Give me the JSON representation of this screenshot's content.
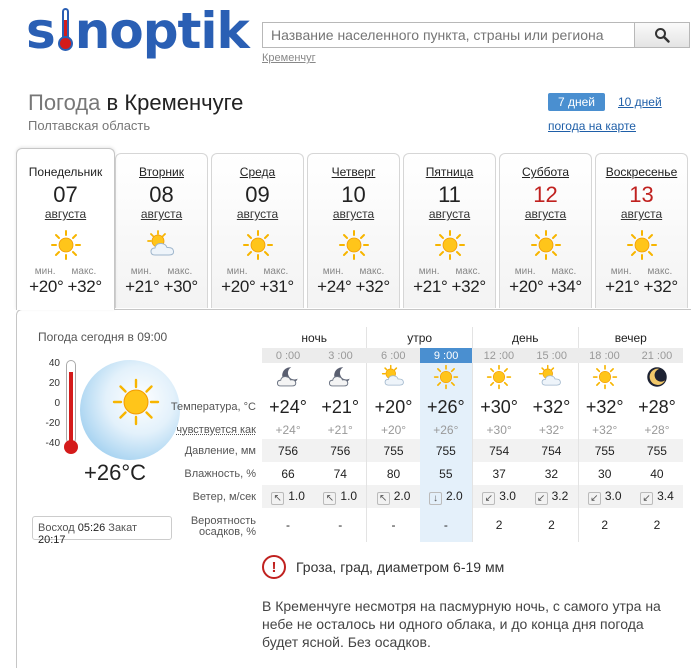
{
  "logo": {
    "pre": "s",
    "post": "noptik"
  },
  "search": {
    "placeholder": "Название населенного пункта, страны или региона",
    "hint": "Кременчуг"
  },
  "title": {
    "prefix": "Погода",
    "city": "в Кременчуге"
  },
  "region": "Полтавская область",
  "tabs": {
    "seven": "7 дней",
    "ten": "10 дней",
    "map": "погода на карте"
  },
  "days": [
    {
      "name": "Понедельник",
      "date": "07",
      "month": "августа",
      "icon": "sun-icon",
      "min_label": "мин.",
      "max_label": "макс.",
      "min": "+20°",
      "max": "+32°",
      "weekend": false,
      "active": true
    },
    {
      "name": "Вторник",
      "date": "08",
      "month": "августа",
      "icon": "sun-cloud-icon",
      "min_label": "мин.",
      "max_label": "макс.",
      "min": "+21°",
      "max": "+30°",
      "weekend": false,
      "active": false
    },
    {
      "name": "Среда",
      "date": "09",
      "month": "августа",
      "icon": "sun-icon",
      "min_label": "мин.",
      "max_label": "макс.",
      "min": "+20°",
      "max": "+31°",
      "weekend": false,
      "active": false
    },
    {
      "name": "Четверг",
      "date": "10",
      "month": "августа",
      "icon": "sun-icon",
      "min_label": "мин.",
      "max_label": "макс.",
      "min": "+24°",
      "max": "+32°",
      "weekend": false,
      "active": false
    },
    {
      "name": "Пятница",
      "date": "11",
      "month": "августа",
      "icon": "sun-icon",
      "min_label": "мин.",
      "max_label": "макс.",
      "min": "+21°",
      "max": "+32°",
      "weekend": false,
      "active": false
    },
    {
      "name": "Суббота",
      "date": "12",
      "month": "августа",
      "icon": "sun-icon",
      "min_label": "мин.",
      "max_label": "макс.",
      "min": "+20°",
      "max": "+34°",
      "weekend": true,
      "active": false
    },
    {
      "name": "Воскресенье",
      "date": "13",
      "month": "августа",
      "icon": "sun-icon",
      "min_label": "мин.",
      "max_label": "макс.",
      "min": "+21°",
      "max": "+32°",
      "weekend": true,
      "active": false
    }
  ],
  "now": {
    "label": "Погода сегодня в 09:00",
    "scale": [
      "40",
      "20",
      "0",
      "-20",
      "-40"
    ],
    "temp": "+26°C",
    "sunrise_label": "Восход",
    "sunrise": "05:26",
    "sunset_label": "Закат",
    "sunset": "20:17"
  },
  "table": {
    "groups": [
      "ночь",
      "утро",
      "день",
      "вечер"
    ],
    "hours": [
      "0 :00",
      "3 :00",
      "6 :00",
      "9 :00",
      "12 :00",
      "15 :00",
      "18 :00",
      "21 :00"
    ],
    "current_index": 3,
    "icons": [
      "moon-cloud-icon",
      "moon-cloud-icon",
      "sun-cloud-icon",
      "sun-icon",
      "sun-icon",
      "sun-cloud-icon",
      "sun-icon",
      "moon-icon"
    ],
    "labels": {
      "temp": "Температура, °C",
      "feels": "чувствуется как",
      "pressure": "Давление, мм",
      "humidity": "Влажность, %",
      "wind": "Ветер, м/сек",
      "precip1": "Вероятность",
      "precip2": "осадков, %"
    },
    "temp": [
      "+24°",
      "+21°",
      "+20°",
      "+26°",
      "+30°",
      "+32°",
      "+32°",
      "+28°"
    ],
    "feels": [
      "+24°",
      "+21°",
      "+20°",
      "+26°",
      "+30°",
      "+32°",
      "+32°",
      "+28°"
    ],
    "pressure": [
      "756",
      "756",
      "755",
      "755",
      "754",
      "754",
      "755",
      "755"
    ],
    "humidity": [
      "66",
      "74",
      "80",
      "55",
      "37",
      "32",
      "30",
      "40"
    ],
    "wind_dir": [
      "↖",
      "↖",
      "↖",
      "↓",
      "↙",
      "↙",
      "↙",
      "↙"
    ],
    "wind": [
      "1.0",
      "1.0",
      "2.0",
      "2.0",
      "3.0",
      "3.2",
      "3.0",
      "3.4"
    ],
    "precip": [
      "-",
      "-",
      "-",
      "-",
      "2",
      "2",
      "2",
      "2"
    ]
  },
  "alert": "Гроза, град, диаметром 6-19 мм",
  "description": "В Кременчуге несмотря на пасмурную ночь, с самого утра на небе не осталось ни одного облака, и до конца дня погода будет ясной. Без осадков.",
  "colors": {
    "brand": "#2a5fb4",
    "accent": "#4a8fd0",
    "weekend": "#c0211f",
    "sun": "#f7b500"
  }
}
